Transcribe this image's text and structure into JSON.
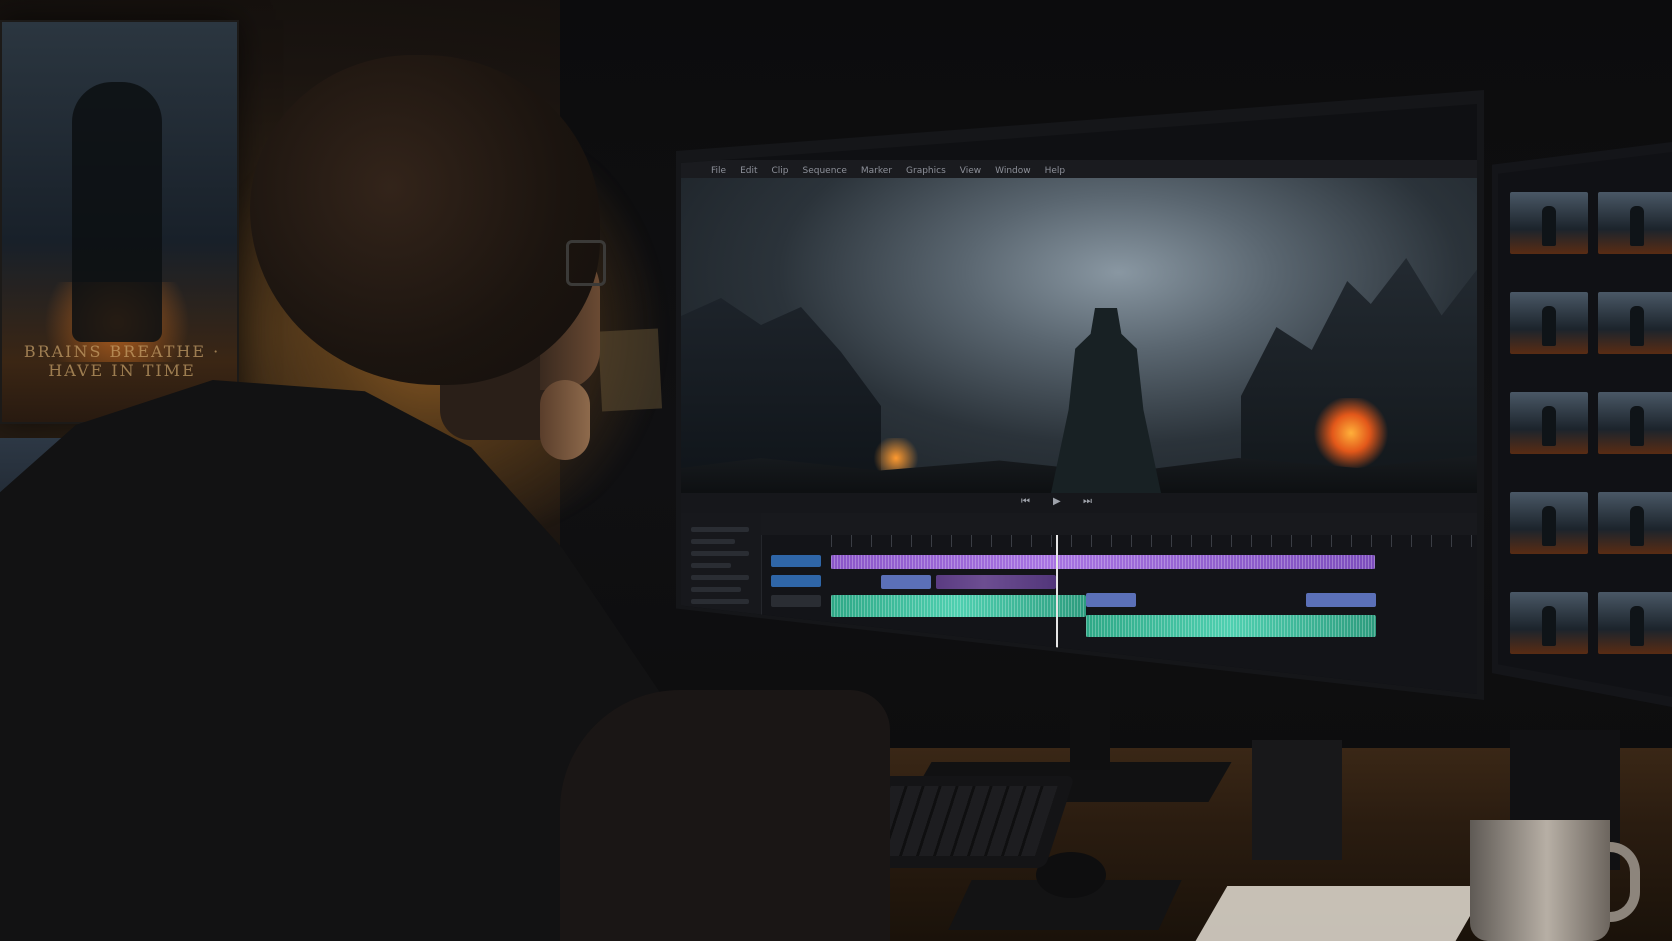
{
  "scene": {
    "caption": "",
    "colors": {
      "shirt": "#121213",
      "warm_light": "#8a5a24",
      "timeline_purple": "#a874e2",
      "timeline_teal": "#4fd0b0",
      "timeline_blue": "#5b70b8",
      "fire": "#e3581a"
    }
  },
  "poster": {
    "title": "BRAINS BREATHE · HAVE IN TIME"
  },
  "editor": {
    "menu_items": [
      "File",
      "Edit",
      "Clip",
      "Sequence",
      "Marker",
      "Graphics",
      "View",
      "Window",
      "Help"
    ],
    "transport_icons": [
      "step-back-icon",
      "play-icon",
      "step-forward-icon"
    ]
  },
  "tracks": {
    "video_track_color": "#a874e2",
    "audio_track_color": "#4fd0b0"
  }
}
